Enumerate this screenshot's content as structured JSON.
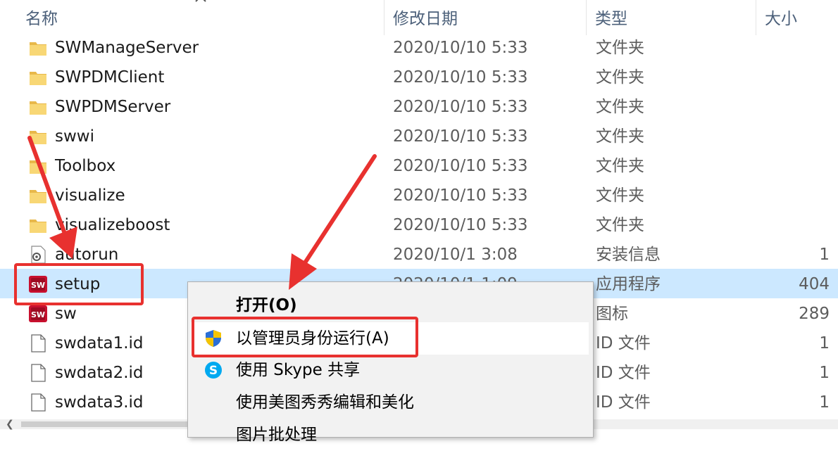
{
  "columns": {
    "name": "名称",
    "date": "修改日期",
    "type": "类型",
    "size": "大小"
  },
  "files": [
    {
      "name": "SWManageServer",
      "date": "2020/10/10 5:33",
      "type": "文件夹",
      "size": "",
      "icon": "folder-icon"
    },
    {
      "name": "SWPDMClient",
      "date": "2020/10/10 5:33",
      "type": "文件夹",
      "size": "",
      "icon": "folder-icon"
    },
    {
      "name": "SWPDMServer",
      "date": "2020/10/10 5:33",
      "type": "文件夹",
      "size": "",
      "icon": "folder-icon"
    },
    {
      "name": "swwi",
      "date": "2020/10/10 5:33",
      "type": "文件夹",
      "size": "",
      "icon": "folder-icon"
    },
    {
      "name": "Toolbox",
      "date": "2020/10/10 5:33",
      "type": "文件夹",
      "size": "",
      "icon": "folder-icon"
    },
    {
      "name": "visualize",
      "date": "2020/10/10 5:33",
      "type": "文件夹",
      "size": "",
      "icon": "folder-icon"
    },
    {
      "name": "visualizeboost",
      "date": "2020/10/10 5:33",
      "type": "文件夹",
      "size": "",
      "icon": "folder-icon"
    },
    {
      "name": "autorun",
      "date": "2020/10/1 3:08",
      "type": "安装信息",
      "size": "1",
      "icon": "settings-file-icon"
    },
    {
      "name": "setup",
      "date": "2020/10/1 1:09",
      "type": "应用程序",
      "size": "404",
      "icon": "solidworks-icon",
      "selected": true
    },
    {
      "name": "sw",
      "date": "",
      "type": "图标",
      "size": "289",
      "icon": "solidworks-icon"
    },
    {
      "name": "swdata1.id",
      "date": "",
      "type": "ID 文件",
      "size": "1",
      "icon": "file-icon"
    },
    {
      "name": "swdata2.id",
      "date": "",
      "type": "ID 文件",
      "size": "1",
      "icon": "file-icon"
    },
    {
      "name": "swdata3.id",
      "date": "",
      "type": "ID 文件",
      "size": "1",
      "icon": "file-icon"
    }
  ],
  "context_menu": {
    "open": "打开(O)",
    "run_as_admin": "以管理员身份运行(A)",
    "share_skype": "使用 Skype 共享",
    "meitu": "使用美图秀秀编辑和美化",
    "partial": "图片批处理"
  },
  "colors": {
    "selection": "#cce8ff",
    "annotation": "#e8312f",
    "folder": "#f8d775"
  }
}
